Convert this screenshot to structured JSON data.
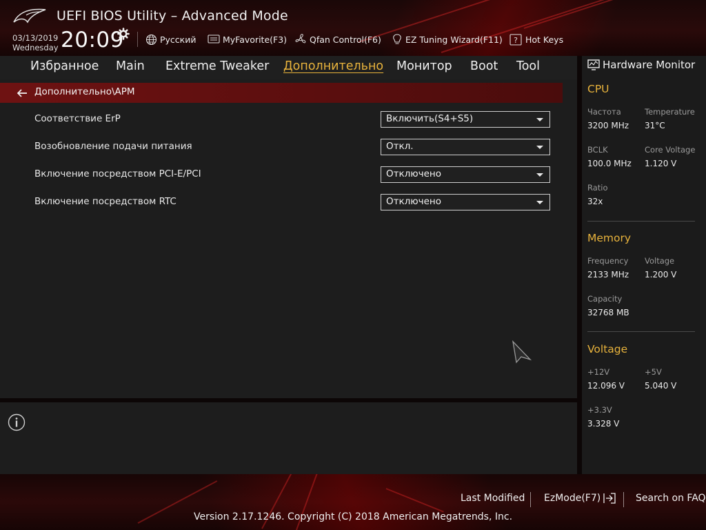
{
  "header": {
    "title": "UEFI BIOS Utility – Advanced Mode",
    "date": "03/13/2019",
    "weekday": "Wednesday",
    "time": "20:09",
    "items": {
      "language": "Русский",
      "myfavorite": "MyFavorite(F3)",
      "qfan": "Qfan Control(F6)",
      "ez_tuning": "EZ Tuning Wizard(F11)",
      "hotkeys": "Hot Keys"
    }
  },
  "tabs": [
    {
      "label": "Избранное"
    },
    {
      "label": "Main"
    },
    {
      "label": "Extreme Tweaker"
    },
    {
      "label": "Дополнительно",
      "active": true
    },
    {
      "label": "Монитор"
    },
    {
      "label": "Boot"
    },
    {
      "label": "Tool"
    }
  ],
  "breadcrumb": "Дополнительно\\APM",
  "settings": [
    {
      "label": "Соответствие ErP",
      "value": "Включить(S4+S5)"
    },
    {
      "label": "Возобновление подачи питания",
      "value": "Откл."
    },
    {
      "label": "Включение посредством PCI-E/PCI",
      "value": "Отключено"
    },
    {
      "label": "Включение посредством RTC",
      "value": "Отключено"
    }
  ],
  "hardware_monitor": {
    "title": "Hardware Monitor",
    "cpu": {
      "heading": "CPU",
      "freq_label": "Частота",
      "freq_value": "3200 MHz",
      "temp_label": "Temperature",
      "temp_value": "31°C",
      "bclk_label": "BCLK",
      "bclk_value": "100.0 MHz",
      "core_voltage_label": "Core Voltage",
      "core_voltage_value": "1.120 V",
      "ratio_label": "Ratio",
      "ratio_value": "32x"
    },
    "memory": {
      "heading": "Memory",
      "freq_label": "Frequency",
      "freq_value": "2133 MHz",
      "voltage_label": "Voltage",
      "voltage_value": "1.200 V",
      "capacity_label": "Capacity",
      "capacity_value": "32768 MB"
    },
    "voltage": {
      "heading": "Voltage",
      "v12_label": "+12V",
      "v12_value": "12.096 V",
      "v5_label": "+5V",
      "v5_value": "5.040 V",
      "v33_label": "+3.3V",
      "v33_value": "3.328 V"
    }
  },
  "footer": {
    "last_modified": "Last Modified",
    "ezmode": "EzMode(F7)",
    "search_faq": "Search on FAQ",
    "copyright": "Version 2.17.1246. Copyright (C) 2018 American Megatrends, Inc."
  },
  "colors": {
    "accent": "#e8b33c",
    "breadcrumb_bg": "#6e1212",
    "panel_bg": "#1d1d1d"
  }
}
